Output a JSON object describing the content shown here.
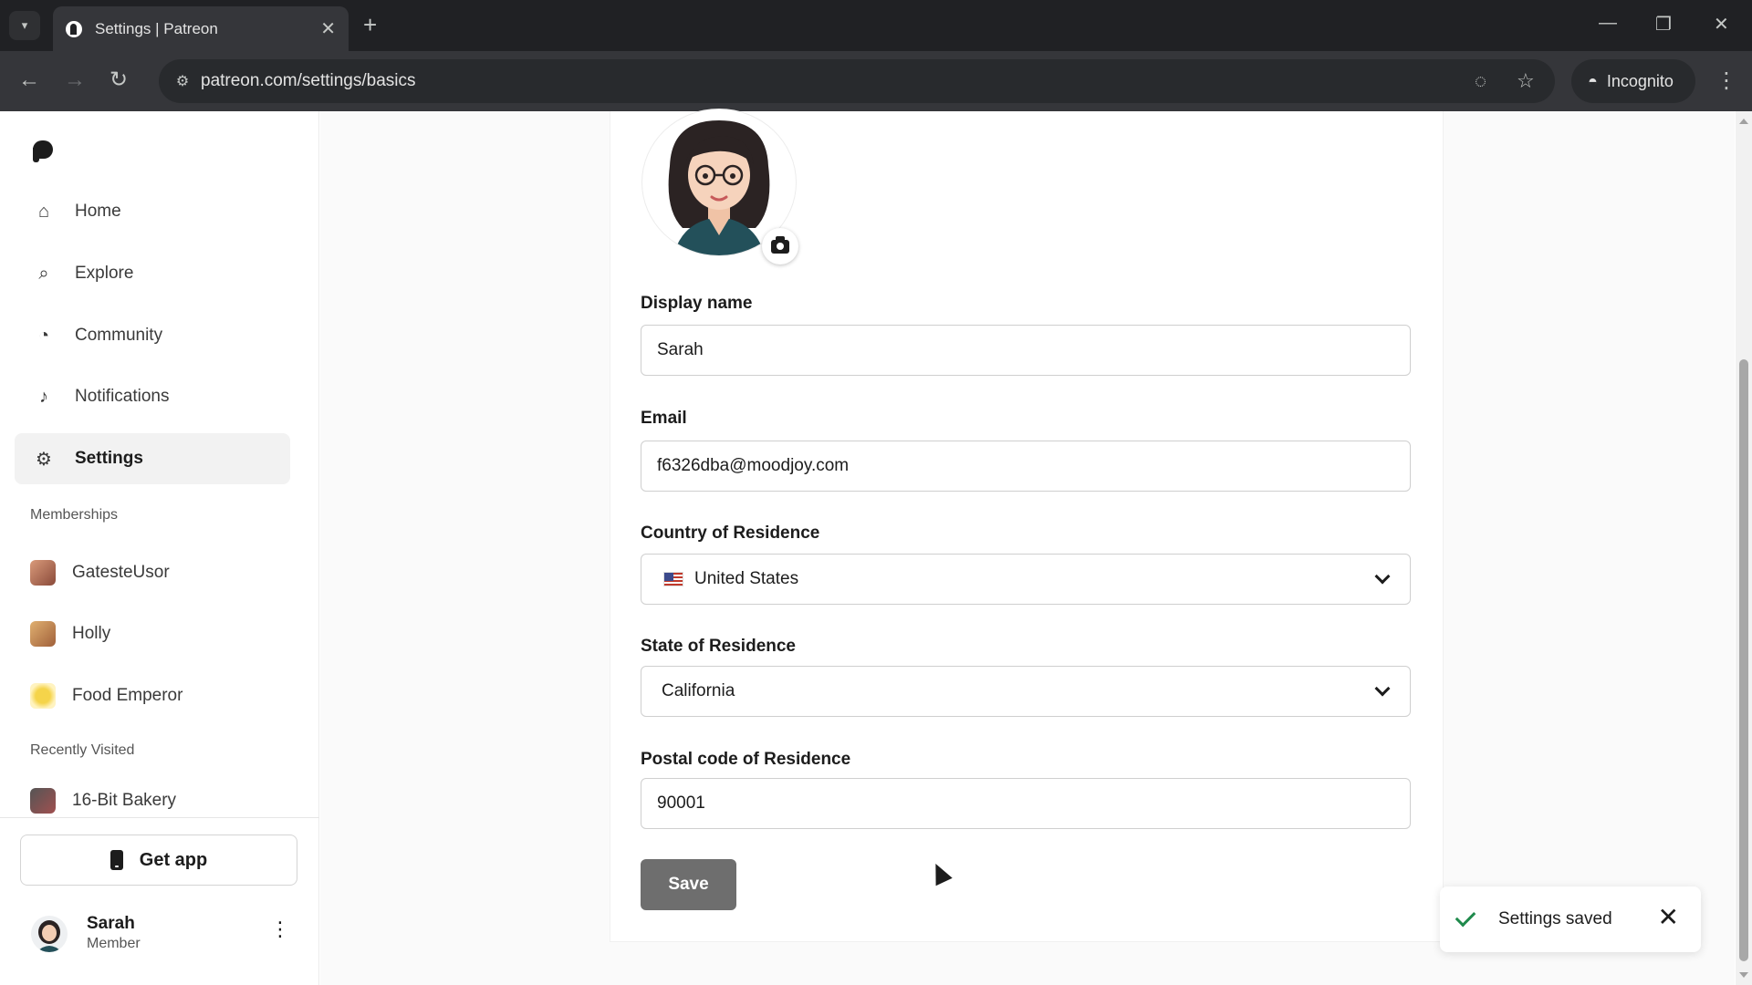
{
  "browser": {
    "tab_title": "Settings | Patreon",
    "url": "patreon.com/settings/basics",
    "incognito_label": "Incognito"
  },
  "sidebar": {
    "nav": [
      {
        "label": "Home",
        "icon": "home-icon"
      },
      {
        "label": "Explore",
        "icon": "search-icon"
      },
      {
        "label": "Community",
        "icon": "chat-icon"
      },
      {
        "label": "Notifications",
        "icon": "bell-icon"
      },
      {
        "label": "Settings",
        "icon": "gear-icon",
        "active": true
      }
    ],
    "memberships_label": "Memberships",
    "memberships": [
      {
        "label": "GatesteUsor"
      },
      {
        "label": "Holly"
      },
      {
        "label": "Food Emperor"
      }
    ],
    "recently_visited_label": "Recently Visited",
    "recently_visited": [
      {
        "label": "16-Bit Bakery"
      }
    ],
    "get_app_label": "Get app",
    "user": {
      "name": "Sarah",
      "role": "Member"
    }
  },
  "form": {
    "display_name": {
      "label": "Display name",
      "value": "Sarah"
    },
    "email": {
      "label": "Email",
      "value": "f6326dba@moodjoy.com"
    },
    "country": {
      "label": "Country of Residence",
      "value": "United States"
    },
    "state": {
      "label": "State of Residence",
      "value": "California"
    },
    "postal": {
      "label": "Postal code of Residence",
      "value": "90001"
    },
    "save_label": "Save"
  },
  "toast": {
    "message": "Settings saved"
  },
  "colors": {
    "accent_dark": "#1c1c1c",
    "save_button": "#6e6e6e",
    "success_check": "#1f8a4c"
  }
}
